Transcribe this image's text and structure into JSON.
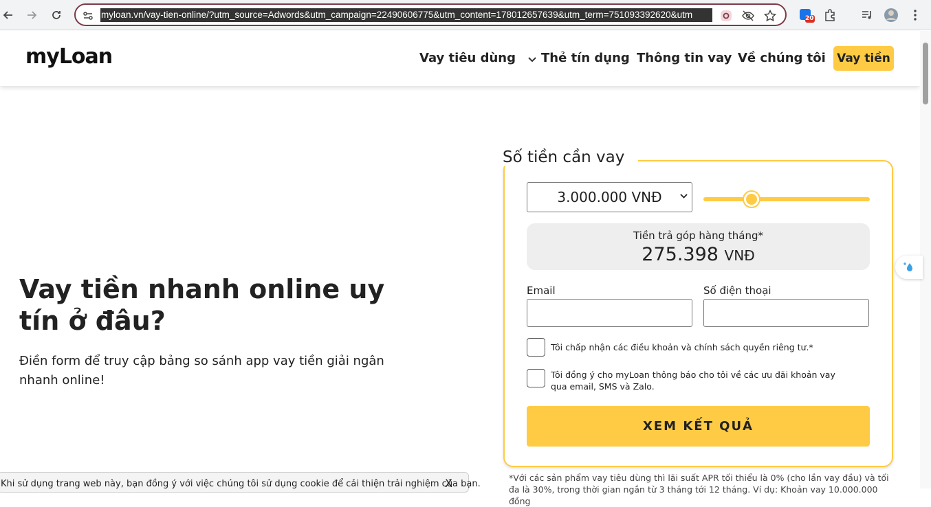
{
  "browser": {
    "url": "myloan.vn/vay-tien-online/?utm_source=Adwords&utm_campaign=22490606775&utm_content=178012657639&utm_term=751093392620&utm",
    "extension_badge": "20"
  },
  "header": {
    "logo": "myLoan",
    "menu": [
      {
        "label": "Vay tiêu dùng"
      },
      {
        "label": "Thẻ tín dụng"
      },
      {
        "label": "Thông tin vay"
      },
      {
        "label": "Về chúng tôi"
      }
    ],
    "cta_label": "Vay tiền"
  },
  "hero": {
    "title": "Vay tiền nhanh online uy tín ở đâu?",
    "subtitle": "Điền form để truy cập bảng so sánh app vay tiền giải ngân nhanh online!"
  },
  "form": {
    "title": "Số tiền cần vay",
    "amount_selected": "3.000.000 VNĐ",
    "slider_fraction": 0.29,
    "monthly_label": "Tiền trả góp hàng tháng*",
    "monthly_value": "275.398",
    "monthly_unit": "VNĐ",
    "email_label": "Email",
    "phone_label": "Số điện thoại",
    "consent_terms": "Tôi chấp nhận các điều khoản và chính sách quyền riêng tư.*",
    "consent_marketing": "Tôi đồng ý cho myLoan thông báo cho tôi về các ưu đãi khoản vay qua email, SMS và Zalo.",
    "submit_label": "XEM KẾT QUẢ",
    "footnote": "*Với các sản phẩm vay tiêu dùng thì lãi suất APR tối thiểu là 0% (cho lần vay đầu) và tối đa là 30%, trong thời gian ngắn từ 3 tháng tới 12 tháng. Ví dụ: Khoản vay 10.000.000 đồng"
  },
  "cookie": {
    "text": "Khi sử dụng trang web này, bạn đồng ý với việc chúng tôi sử dụng cookie để cải thiện trải nghiệm của bạn.",
    "close_label": "X"
  },
  "colors": {
    "accent": "#ffcb44",
    "omnibox_border": "#7b3a46"
  }
}
